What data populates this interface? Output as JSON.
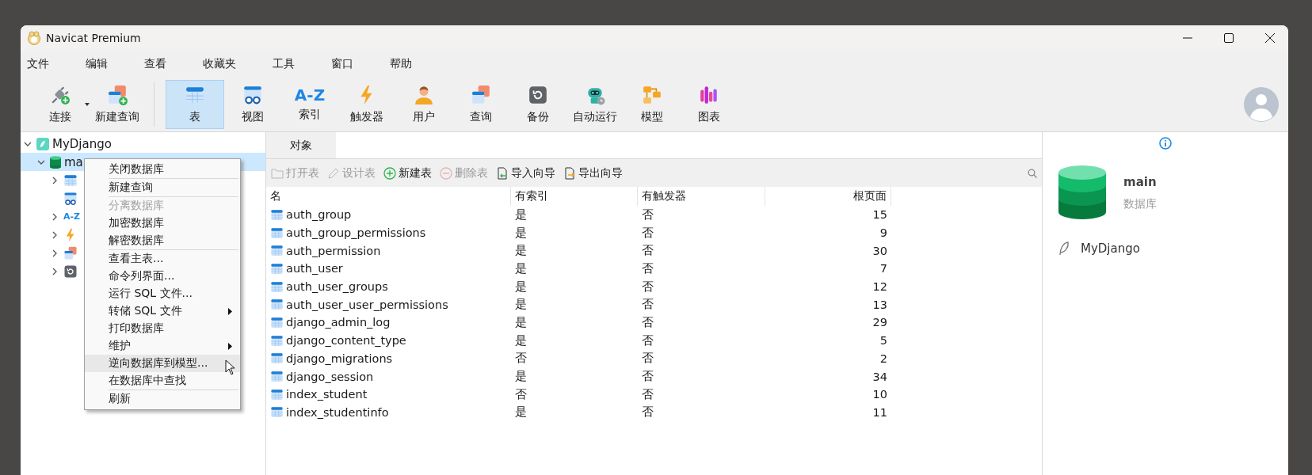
{
  "window": {
    "title": "Navicat Premium"
  },
  "menu": [
    "文件",
    "编辑",
    "查看",
    "收藏夹",
    "工具",
    "窗口",
    "帮助"
  ],
  "toolbar": [
    {
      "label": "连接",
      "kind": "connect",
      "selected": false,
      "dropdown": true
    },
    {
      "label": "新建查询",
      "kind": "newquery",
      "selected": false,
      "dropdown": false
    },
    {
      "label": "表",
      "kind": "table",
      "selected": true,
      "dropdown": false
    },
    {
      "label": "视图",
      "kind": "view",
      "selected": false,
      "dropdown": false
    },
    {
      "label": "索引",
      "kind": "index",
      "glyph": "A-Z",
      "selected": false,
      "dropdown": false
    },
    {
      "label": "触发器",
      "kind": "trigger",
      "selected": false,
      "dropdown": false
    },
    {
      "label": "用户",
      "kind": "user",
      "selected": false,
      "dropdown": false
    },
    {
      "label": "查询",
      "kind": "query",
      "selected": false,
      "dropdown": false
    },
    {
      "label": "备份",
      "kind": "backup",
      "selected": false,
      "dropdown": false
    },
    {
      "label": "自动运行",
      "kind": "robot",
      "selected": false,
      "dropdown": false
    },
    {
      "label": "模型",
      "kind": "model",
      "selected": false,
      "dropdown": false
    },
    {
      "label": "图表",
      "kind": "chart",
      "selected": false,
      "dropdown": false
    }
  ],
  "tree": [
    {
      "label": "MyDjango",
      "kind": "connection",
      "expanded": true,
      "selected": false,
      "children": [
        {
          "label": "ma",
          "kind": "database",
          "expanded": true,
          "selected": true,
          "children": [
            {
              "kind": "table",
              "expanded": false,
              "selected": false
            },
            {
              "kind": "view",
              "selected": false
            },
            {
              "kind": "index",
              "glyph": "A-Z",
              "expanded": false,
              "selected": false
            },
            {
              "kind": "trigger",
              "expanded": false,
              "selected": false
            },
            {
              "kind": "query",
              "expanded": false,
              "selected": false
            },
            {
              "kind": "backup",
              "expanded": false,
              "selected": false
            }
          ]
        }
      ]
    }
  ],
  "context_menu": [
    {
      "kind": "item",
      "label": "关闭数据库",
      "disabled": false,
      "selected": false,
      "submenu": false
    },
    {
      "kind": "separator"
    },
    {
      "kind": "item",
      "label": "新建查询",
      "disabled": false,
      "selected": false,
      "submenu": false
    },
    {
      "kind": "separator"
    },
    {
      "kind": "item",
      "label": "分离数据库",
      "disabled": true,
      "selected": false,
      "submenu": false
    },
    {
      "kind": "item",
      "label": "加密数据库",
      "disabled": false,
      "selected": false,
      "submenu": false
    },
    {
      "kind": "item",
      "label": "解密数据库",
      "disabled": false,
      "selected": false,
      "submenu": false
    },
    {
      "kind": "separator"
    },
    {
      "kind": "item",
      "label": "查看主表...",
      "disabled": false,
      "selected": false,
      "submenu": false
    },
    {
      "kind": "item",
      "label": "命令列界面...",
      "disabled": false,
      "selected": false,
      "submenu": false
    },
    {
      "kind": "item",
      "label": "运行 SQL 文件...",
      "disabled": false,
      "selected": false,
      "submenu": false
    },
    {
      "kind": "item",
      "label": "转储 SQL 文件",
      "disabled": false,
      "selected": false,
      "submenu": true
    },
    {
      "kind": "item",
      "label": "打印数据库",
      "disabled": false,
      "selected": false,
      "submenu": false
    },
    {
      "kind": "item",
      "label": "维护",
      "disabled": false,
      "selected": false,
      "submenu": true
    },
    {
      "kind": "item",
      "label": "逆向数据库到模型...",
      "disabled": false,
      "selected": true,
      "submenu": false
    },
    {
      "kind": "item",
      "label": "在数据库中查找",
      "disabled": false,
      "selected": false,
      "submenu": false
    },
    {
      "kind": "separator"
    },
    {
      "kind": "item",
      "label": "刷新",
      "disabled": false,
      "selected": false,
      "submenu": false
    }
  ],
  "object_tabs": [
    {
      "label": "对象",
      "selected": true
    }
  ],
  "actions": [
    {
      "label": "打开表",
      "kind": "open",
      "disabled": true
    },
    {
      "label": "设计表",
      "kind": "design",
      "disabled": true
    },
    {
      "label": "新建表",
      "kind": "add",
      "disabled": false
    },
    {
      "label": "删除表",
      "kind": "remove",
      "disabled": true
    },
    {
      "label": "导入向导",
      "kind": "import",
      "disabled": false
    },
    {
      "label": "导出向导",
      "kind": "export",
      "disabled": false
    }
  ],
  "table": {
    "columns": [
      {
        "label": "名",
        "numeric": false
      },
      {
        "label": "有索引",
        "numeric": false
      },
      {
        "label": "有触发器",
        "numeric": false
      },
      {
        "label": "根页面",
        "numeric": true
      }
    ],
    "rows": [
      [
        "auth_group",
        "是",
        "否",
        "15"
      ],
      [
        "auth_group_permissions",
        "是",
        "否",
        "9"
      ],
      [
        "auth_permission",
        "是",
        "否",
        "30"
      ],
      [
        "auth_user",
        "是",
        "否",
        "7"
      ],
      [
        "auth_user_groups",
        "是",
        "否",
        "12"
      ],
      [
        "auth_user_user_permissions",
        "是",
        "否",
        "13"
      ],
      [
        "django_admin_log",
        "是",
        "否",
        "29"
      ],
      [
        "django_content_type",
        "是",
        "否",
        "5"
      ],
      [
        "django_migrations",
        "否",
        "否",
        "2"
      ],
      [
        "django_session",
        "是",
        "否",
        "34"
      ],
      [
        "index_student",
        "否",
        "否",
        "10"
      ],
      [
        "index_studentinfo",
        "是",
        "否",
        "11"
      ]
    ]
  },
  "info": {
    "name": "main",
    "type": "数据库",
    "connection": "MyDjango"
  }
}
